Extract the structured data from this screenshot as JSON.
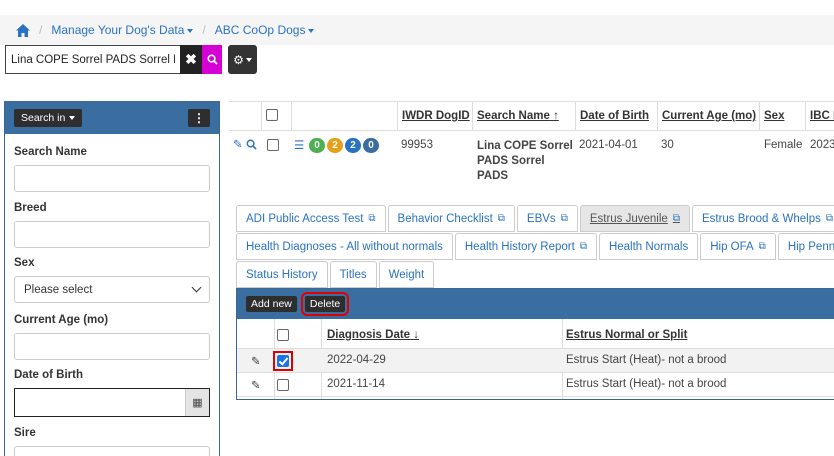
{
  "breadcrumb": {
    "items": [
      "Manage Your Dog's Data",
      "ABC CoOp Dogs"
    ]
  },
  "search": {
    "value": "Lina COPE Sorrel PADS Sorrel PADS"
  },
  "sidebar": {
    "search_in_label": "Search in",
    "kebab_label": "⋮",
    "fields": {
      "search_name": "Search Name",
      "breed": "Breed",
      "sex": "Sex",
      "sex_value": "Please select",
      "current_age": "Current Age (mo)",
      "dob": "Date of Birth",
      "sire": "Sire"
    }
  },
  "grid": {
    "columns": [
      "IWDR DogID",
      "Search Name",
      "Date of Birth",
      "Current Age (mo)",
      "Sex",
      "IBC M"
    ],
    "badges": [
      {
        "label": "0",
        "color": "#4caf50"
      },
      {
        "label": "2",
        "color": "#e6a019"
      },
      {
        "label": "2",
        "color": "#2a72c2"
      },
      {
        "label": "0",
        "color": "#3b6ea0"
      }
    ],
    "row": {
      "id": "99953",
      "name": "Lina COPE Sorrel PADS Sorrel PADS",
      "dob": "2021-04-01",
      "age": "30",
      "sex": "Female",
      "ibc": "2023"
    }
  },
  "tabs": {
    "row1": [
      "ADI Public Access Test",
      "Behavior Checklist",
      "EBVs",
      "Estrus Juvenile",
      "Estrus Brood & Whelps"
    ],
    "row2": [
      "Health Diagnoses - All without normals",
      "Health History Report",
      "Health Normals",
      "Hip OFA",
      "Hip Penn"
    ],
    "row3": [
      "Status History",
      "Titles",
      "Weight"
    ]
  },
  "subpanel": {
    "add_label": "Add new",
    "delete_label": "Delete",
    "col_date": "Diagnosis Date",
    "col_estrus": "Estrus Normal or Split",
    "rows": [
      {
        "date": "2022-04-29",
        "estrus": "Estrus Start (Heat)- not a brood",
        "checked": true
      },
      {
        "date": "2021-11-14",
        "estrus": "Estrus Start (Heat)- not a brood",
        "checked": false
      }
    ]
  }
}
